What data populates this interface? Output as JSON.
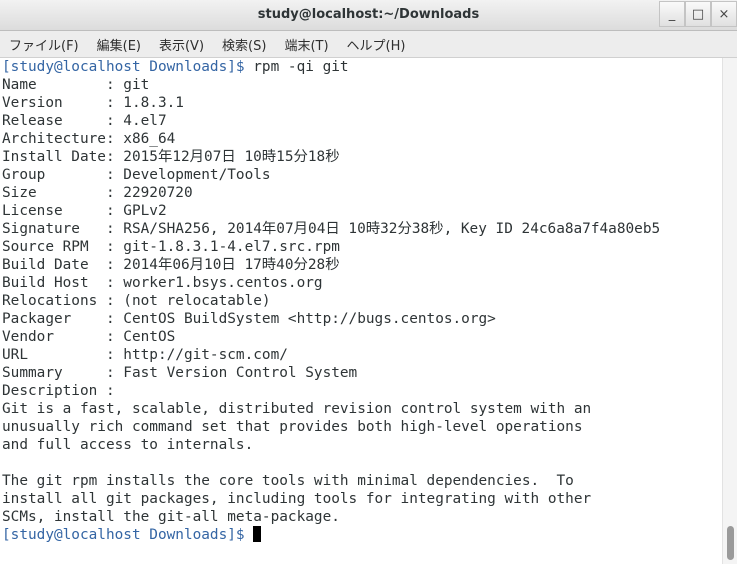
{
  "window": {
    "title": "study@localhost:~/Downloads",
    "buttons": [
      "_",
      "□",
      "×"
    ]
  },
  "menu": [
    "ファイル(F)",
    "編集(E)",
    "表示(V)",
    "検索(S)",
    "端末(T)",
    "ヘルプ(H)"
  ],
  "terminal": {
    "prompt": "[study@localhost Downloads]$",
    "command": " rpm -qi git",
    "output": [
      "Name        : git",
      "Version     : 1.8.3.1",
      "Release     : 4.el7",
      "Architecture: x86_64",
      "Install Date: 2015年12月07日 10時15分18秒",
      "Group       : Development/Tools",
      "Size        : 22920720",
      "License     : GPLv2",
      "Signature   : RSA/SHA256, 2014年07月04日 10時32分38秒, Key ID 24c6a8a7f4a80eb5",
      "Source RPM  : git-1.8.3.1-4.el7.src.rpm",
      "Build Date  : 2014年06月10日 17時40分28秒",
      "Build Host  : worker1.bsys.centos.org",
      "Relocations : (not relocatable)",
      "Packager    : CentOS BuildSystem <http://bugs.centos.org>",
      "Vendor      : CentOS",
      "URL         : http://git-scm.com/",
      "Summary     : Fast Version Control System",
      "Description :",
      "Git is a fast, scalable, distributed revision control system with an",
      "unusually rich command set that provides both high-level operations",
      "and full access to internals.",
      "",
      "The git rpm installs the core tools with minimal dependencies.  To",
      "install all git packages, including tools for integrating with other",
      "SCMs, install the git-all meta-package."
    ],
    "final_prompt": "[study@localhost Downloads]$",
    "final_input": " "
  },
  "colors": {
    "prompt": "#3465a4",
    "text": "#2e3436",
    "background": "#ffffff"
  }
}
